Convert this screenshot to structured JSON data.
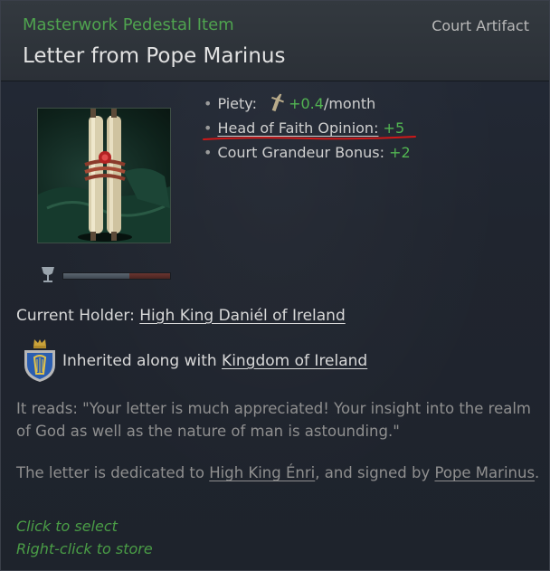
{
  "header": {
    "rarity": "Masterwork Pedestal Item",
    "type": "Court Artifact",
    "title": "Letter from Pope Marinus"
  },
  "modifiers": [
    {
      "label": "Piety:",
      "icon": "piety-icon",
      "value": "+0.4",
      "suffix": "/month"
    },
    {
      "label": "Head of Faith Opinion:",
      "value": "+5"
    },
    {
      "label": "Court Grandeur Bonus:",
      "value": "+2"
    }
  ],
  "durability": {
    "fraction": 0.62
  },
  "holder": {
    "label": "Current Holder:",
    "name": "High King Daniél of Ireland"
  },
  "inheritance": {
    "label": "Inherited along with",
    "title": "Kingdom of Ireland"
  },
  "description": "It reads: \"Your letter is much appreciated! Your insight into the realm of God as well as the nature of man is astounding.\"",
  "dedication": {
    "prefix": "The letter is dedicated to",
    "dedicatee": "High King Énri",
    "middle": ", and signed by",
    "signer": "Pope Marinus",
    "suffix": "."
  },
  "hints": {
    "select": "Click to select",
    "store": "Right-click to store"
  },
  "colors": {
    "positive": "#52b552",
    "rarity": "#4fa34f",
    "hint": "#4a9d46",
    "annotation": "#d01818"
  }
}
